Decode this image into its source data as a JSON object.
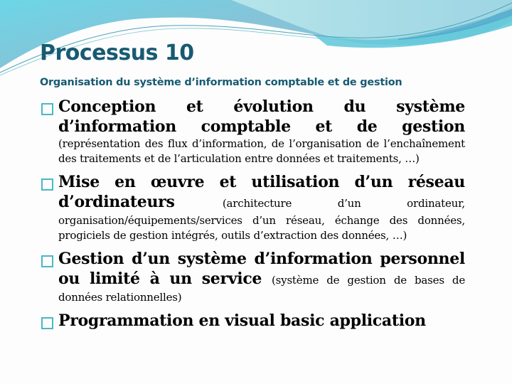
{
  "slide": {
    "title": "Processus 10",
    "subtitle": "Organisation du système d’information comptable et de gestion",
    "colors": {
      "title": "#175a72",
      "bullet_box": "#4ab8c4",
      "wave_light": "#a9dfe6",
      "wave_mid": "#7fc3d6",
      "wave_dark": "#3ea9c8"
    },
    "bullets": [
      {
        "icon": "square-bullet-icon",
        "heading": "Conception et évolution du système d’information comptable et de gestion",
        "detail": "(représentation des flux d’information, de l’organisation de l’enchaînement des traitements et de l’articulation entre données et traitements, …)"
      },
      {
        "icon": "square-bullet-icon",
        "heading": "Mise en œuvre et utilisation d’un réseau d’ordinateurs",
        "inline_detail": "(architecture d’un ordinateur,",
        "detail": "organisation/équipements/services d’un réseau, échange des données, progiciels de gestion intégrés, outils d’extraction des données, …)"
      },
      {
        "icon": "square-bullet-icon",
        "heading": "Gestion d’un système d’information personnel ou limité à un service",
        "inline_detail": "(système de gestion de bases de",
        "detail": "données relationnelles)"
      },
      {
        "icon": "square-bullet-icon",
        "heading": "Programmation en visual basic application"
      }
    ]
  }
}
